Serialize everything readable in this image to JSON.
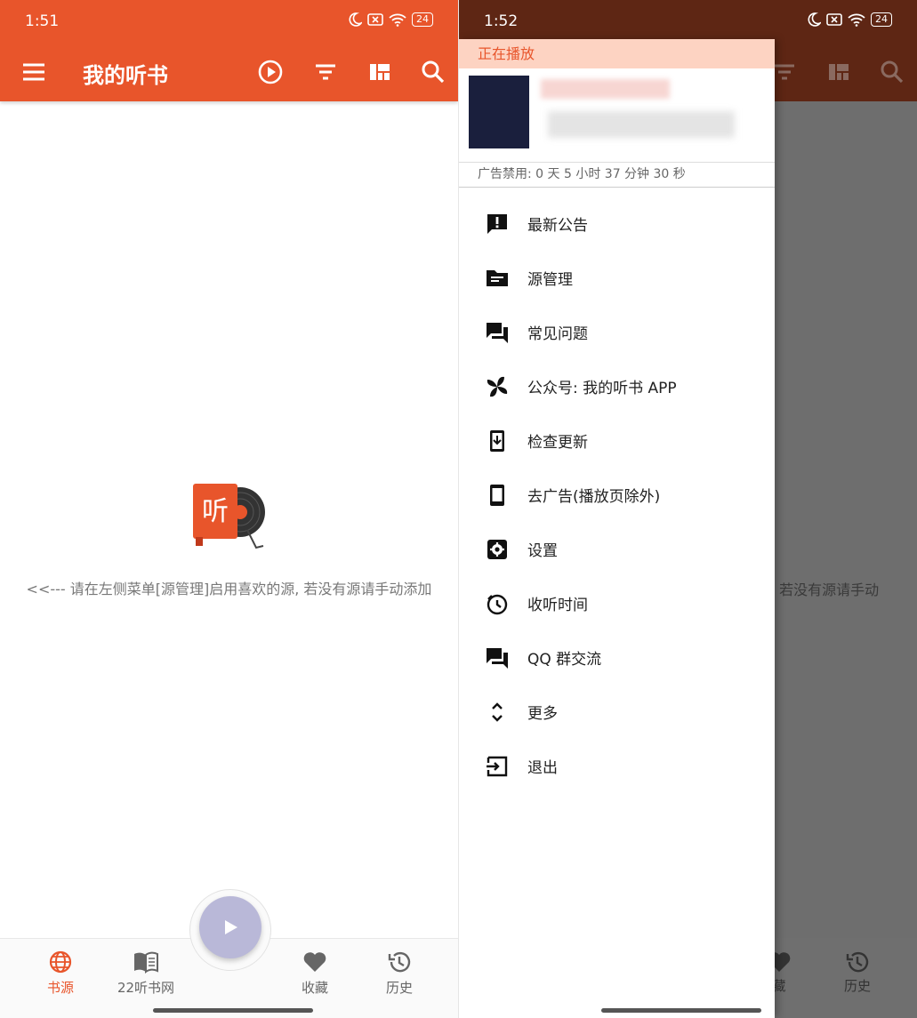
{
  "left": {
    "status_time": "1:51",
    "battery": "24",
    "title": "我的听书",
    "empty_icon_text": "听",
    "empty_message": "<<--- 请在左侧菜单[源管理]启用喜欢的源, 若没有源请手动添加",
    "nav": [
      {
        "label": "书源",
        "icon": "globe-icon",
        "active": true
      },
      {
        "label": "22听书网",
        "icon": "book-open-icon",
        "active": false
      },
      {
        "label": "收藏",
        "icon": "heart-icon",
        "active": false
      },
      {
        "label": "历史",
        "icon": "history-icon",
        "active": false
      }
    ]
  },
  "right": {
    "status_time": "1:52",
    "battery": "24",
    "background_message": ", 若没有源请手动",
    "bg_nav": [
      {
        "label": "藏"
      },
      {
        "label": "历史"
      }
    ],
    "drawer": {
      "now_playing_label": "正在播放",
      "ad_disabled_text": "广告禁用: 0 天 5 小时 37 分钟 30 秒",
      "menu": [
        {
          "label": "最新公告",
          "icon": "announcement-icon"
        },
        {
          "label": "源管理",
          "icon": "folder-icon"
        },
        {
          "label": "常见问题",
          "icon": "forum-icon"
        },
        {
          "label": "公众号: 我的听书 APP",
          "icon": "pinwheel-icon"
        },
        {
          "label": "检查更新",
          "icon": "update-download-icon"
        },
        {
          "label": "去广告(播放页除外)",
          "icon": "phone-icon"
        },
        {
          "label": "设置",
          "icon": "settings-icon"
        },
        {
          "label": "收听时间",
          "icon": "timer-icon"
        },
        {
          "label": "QQ 群交流",
          "icon": "chat-icon"
        },
        {
          "label": "更多",
          "icon": "expand-icon"
        },
        {
          "label": "退出",
          "icon": "exit-icon"
        }
      ]
    }
  },
  "colors": {
    "primary": "#e8552b",
    "primary_dark": "#5e2614",
    "scrim": "#6e6e6e",
    "fab": "#b9b8d8",
    "now_playing_bg": "#fdd3c2"
  }
}
